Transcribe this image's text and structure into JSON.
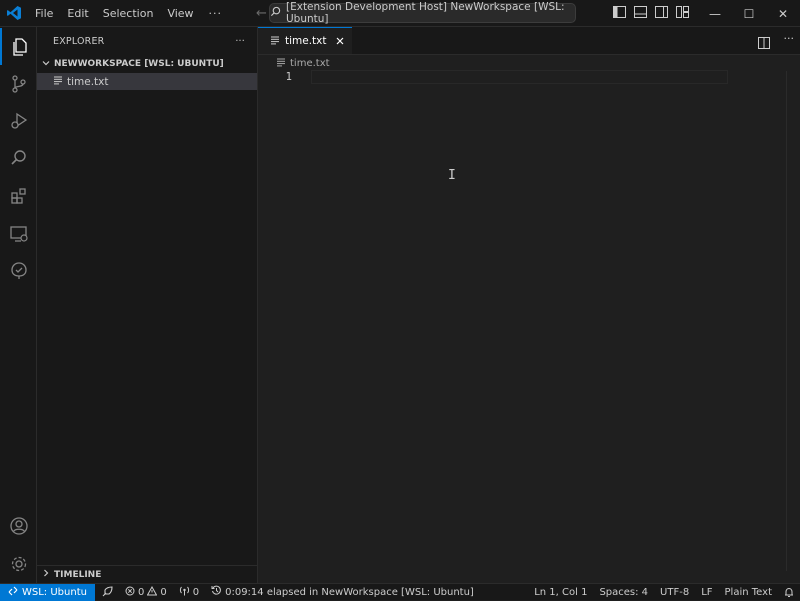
{
  "titlebar": {
    "menus": [
      "File",
      "Edit",
      "Selection",
      "View"
    ],
    "more": "···",
    "command_center": "[Extension Development Host] NewWorkspace [WSL: Ubuntu]",
    "window": {
      "minimize": "—",
      "maximize": "☐",
      "close": "✕"
    }
  },
  "sidebar": {
    "title": "EXPLORER",
    "more": "···",
    "workspace": "NEWWORKSPACE [WSL: UBUNTU]",
    "files": [
      {
        "name": "time.txt"
      }
    ],
    "timeline": "TIMELINE"
  },
  "editor": {
    "tab": {
      "label": "time.txt"
    },
    "breadcrumb": "time.txt",
    "lines": [
      {
        "number": "1",
        "text": ""
      }
    ]
  },
  "statusbar": {
    "remote": "WSL: Ubuntu",
    "errors": "0",
    "warnings": "0",
    "ports": "0",
    "elapsed": "0:09:14 elapsed in NewWorkspace [WSL: Ubuntu]",
    "position": "Ln 1, Col 1",
    "indent": "Spaces: 4",
    "encoding": "UTF-8",
    "eol": "LF",
    "language": "Plain Text"
  },
  "colors": {
    "accent": "#0078d4",
    "background": "#1f1f1f",
    "chrome": "#181818"
  },
  "icons": {
    "activitybar": [
      "files-icon",
      "source-control-icon",
      "run-debug-icon",
      "search-icon",
      "extensions-icon",
      "remote-explorer-icon",
      "testing-icon",
      "account-icon",
      "settings-gear-icon"
    ]
  }
}
